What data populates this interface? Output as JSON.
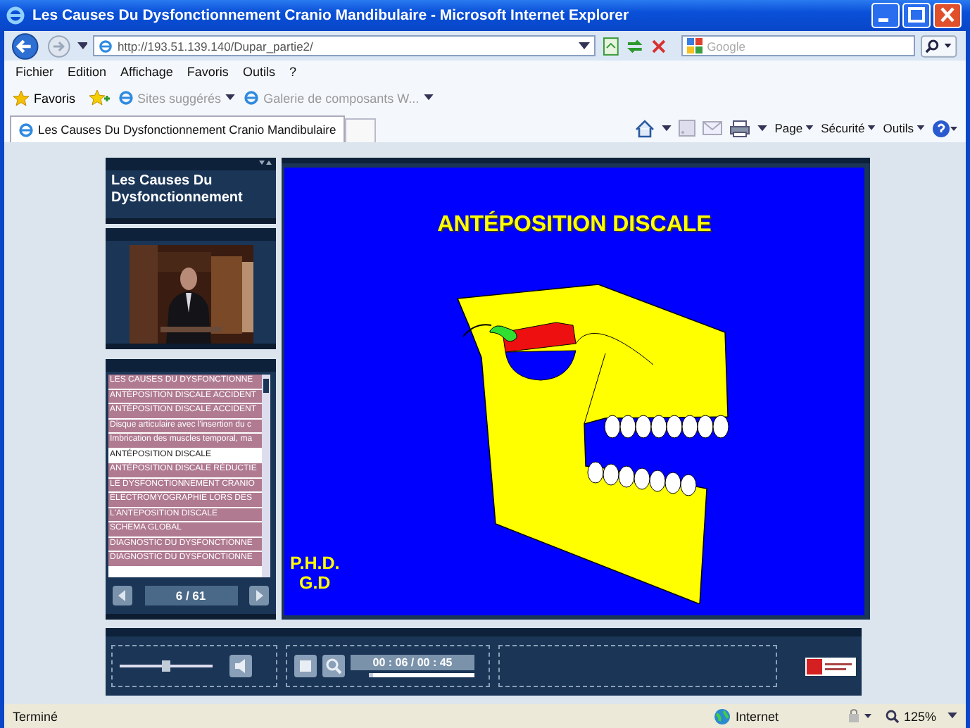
{
  "window": {
    "title": "Les Causes Du Dysfonctionnement Cranio Mandibulaire - Microsoft Internet Explorer"
  },
  "address_bar": {
    "url": "http://193.51.139.140/Dupar_partie2/"
  },
  "search": {
    "placeholder": "Google"
  },
  "menu": [
    "Fichier",
    "Edition",
    "Affichage",
    "Favoris",
    "Outils",
    "?"
  ],
  "favorites_button": "Favoris",
  "favorites_links": [
    "Sites suggérés",
    "Galerie de composants W..."
  ],
  "tabs": [
    {
      "label": "Les Causes Du Dysfonctionnement Cranio Mandibulaire",
      "selected": true
    }
  ],
  "command_bar": [
    "Page",
    "Sécurité",
    "Outils"
  ],
  "course": {
    "title": "Les Causes Du Dysfonctionnement",
    "chapters": [
      {
        "label": "LES CAUSES DU DYSFONCTIONNE",
        "selected": false
      },
      {
        "label": "ANTÉPOSITION DISCALE ACCIDENT",
        "selected": false
      },
      {
        "label": "ANTÉPOSITION DISCALE ACCIDENT",
        "selected": false
      },
      {
        "label": "Disque articulaire avec l'insertion du c",
        "selected": false
      },
      {
        "label": "Imbrication des muscles temporal, ma",
        "selected": false
      },
      {
        "label": "ANTÉPOSITION DISCALE",
        "selected": true
      },
      {
        "label": "ANTÉPOSITION DISCALE RÉDUCTIE",
        "selected": false
      },
      {
        "label": "LE DYSFONCTIONNEMENT  CRANIO",
        "selected": false
      },
      {
        "label": "ELECTROMYOGRAPHIE LORS DES",
        "selected": false
      },
      {
        "label": "L'ANTEPOSITION DISCALE",
        "selected": false
      },
      {
        "label": "SCHEMA GLOBAL",
        "selected": false
      },
      {
        "label": "DIAGNOSTIC DU DYSFONCTIONNE",
        "selected": false
      },
      {
        "label": "DIAGNOSTIC DU DYSFONCTIONNE",
        "selected": false
      }
    ],
    "pager": "6 / 61"
  },
  "slide": {
    "title": "ANTÉPOSITION DISCALE",
    "author": [
      "P.H.D.",
      "G.D"
    ]
  },
  "player": {
    "volume": {
      "level": 0.5
    },
    "time": "00 : 06 / 00 : 45",
    "progress": {
      "level": 0.15
    }
  },
  "status_bar": {
    "status": "Terminé",
    "zone": "Internet",
    "zoom": "125%"
  }
}
